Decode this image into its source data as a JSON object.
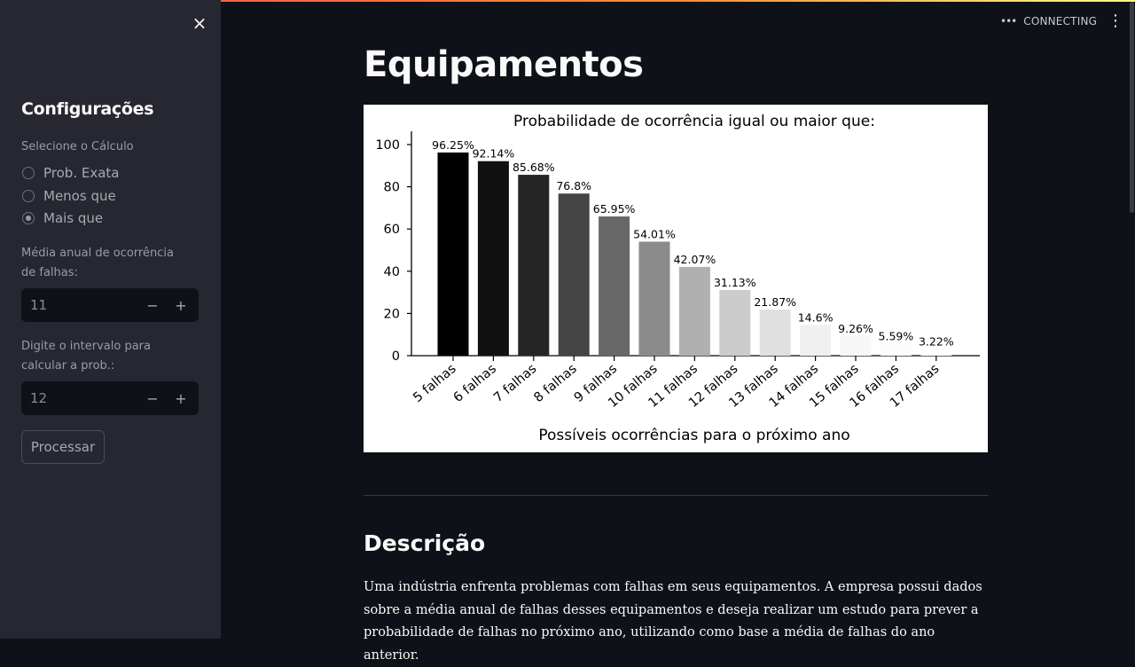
{
  "sidebar": {
    "title": "Configurações",
    "calc_label": "Selecione o Cálculo",
    "options": [
      "Prob. Exata",
      "Menos que",
      "Mais que"
    ],
    "selected": "Mais que",
    "media_label": "Média anual de ocorrência de falhas:",
    "media_value": "11",
    "intervalo_label": "Digite o intervalo para calcular a prob.:",
    "intervalo_value": "12",
    "minus": "−",
    "plus": "+",
    "process_label": "Processar",
    "close_icon": "×"
  },
  "header": {
    "status": "CONNECTING",
    "status_dots": "•••",
    "menu_icon": "⋮"
  },
  "main": {
    "title": "Equipamentos",
    "section_title": "Descrição",
    "description": "Uma indústria enfrenta problemas com falhas em seus equipamentos. A empresa possui dados sobre a média anual de falhas desses equipamentos e deseja realizar um estudo para prever a probabilidade de falhas no próximo ano, utilizando como base a média de falhas do ano anterior."
  },
  "chart_data": {
    "type": "bar",
    "title": "Probabilidade de ocorrência igual ou maior que:",
    "xlabel": "Possíveis ocorrências para o próximo ano",
    "ylabel": "",
    "ylim": [
      0,
      100
    ],
    "yticks": [
      0,
      20,
      40,
      60,
      80,
      100
    ],
    "categories": [
      "5 falhas",
      "6 falhas",
      "7 falhas",
      "8 falhas",
      "9 falhas",
      "10 falhas",
      "11 falhas",
      "12 falhas",
      "13 falhas",
      "14 falhas",
      "15 falhas",
      "16 falhas",
      "17 falhas"
    ],
    "values": [
      96.25,
      92.14,
      85.68,
      76.8,
      65.95,
      54.01,
      42.07,
      31.13,
      21.87,
      14.6,
      9.26,
      5.59,
      3.22
    ],
    "labels": [
      "96.25%",
      "92.14%",
      "85.68%",
      "76.8%",
      "65.95%",
      "54.01%",
      "42.07%",
      "31.13%",
      "21.87%",
      "14.6%",
      "9.26%",
      "5.59%",
      "3.22%"
    ],
    "colors": [
      "#000000",
      "#111111",
      "#252525",
      "#444444",
      "#676767",
      "#8b8b8b",
      "#b0b0b0",
      "#cccccc",
      "#e0e0e0",
      "#f0f0f0",
      "#f7f7f7",
      "#fcfcfc",
      "#ffffff"
    ],
    "grid": false
  }
}
